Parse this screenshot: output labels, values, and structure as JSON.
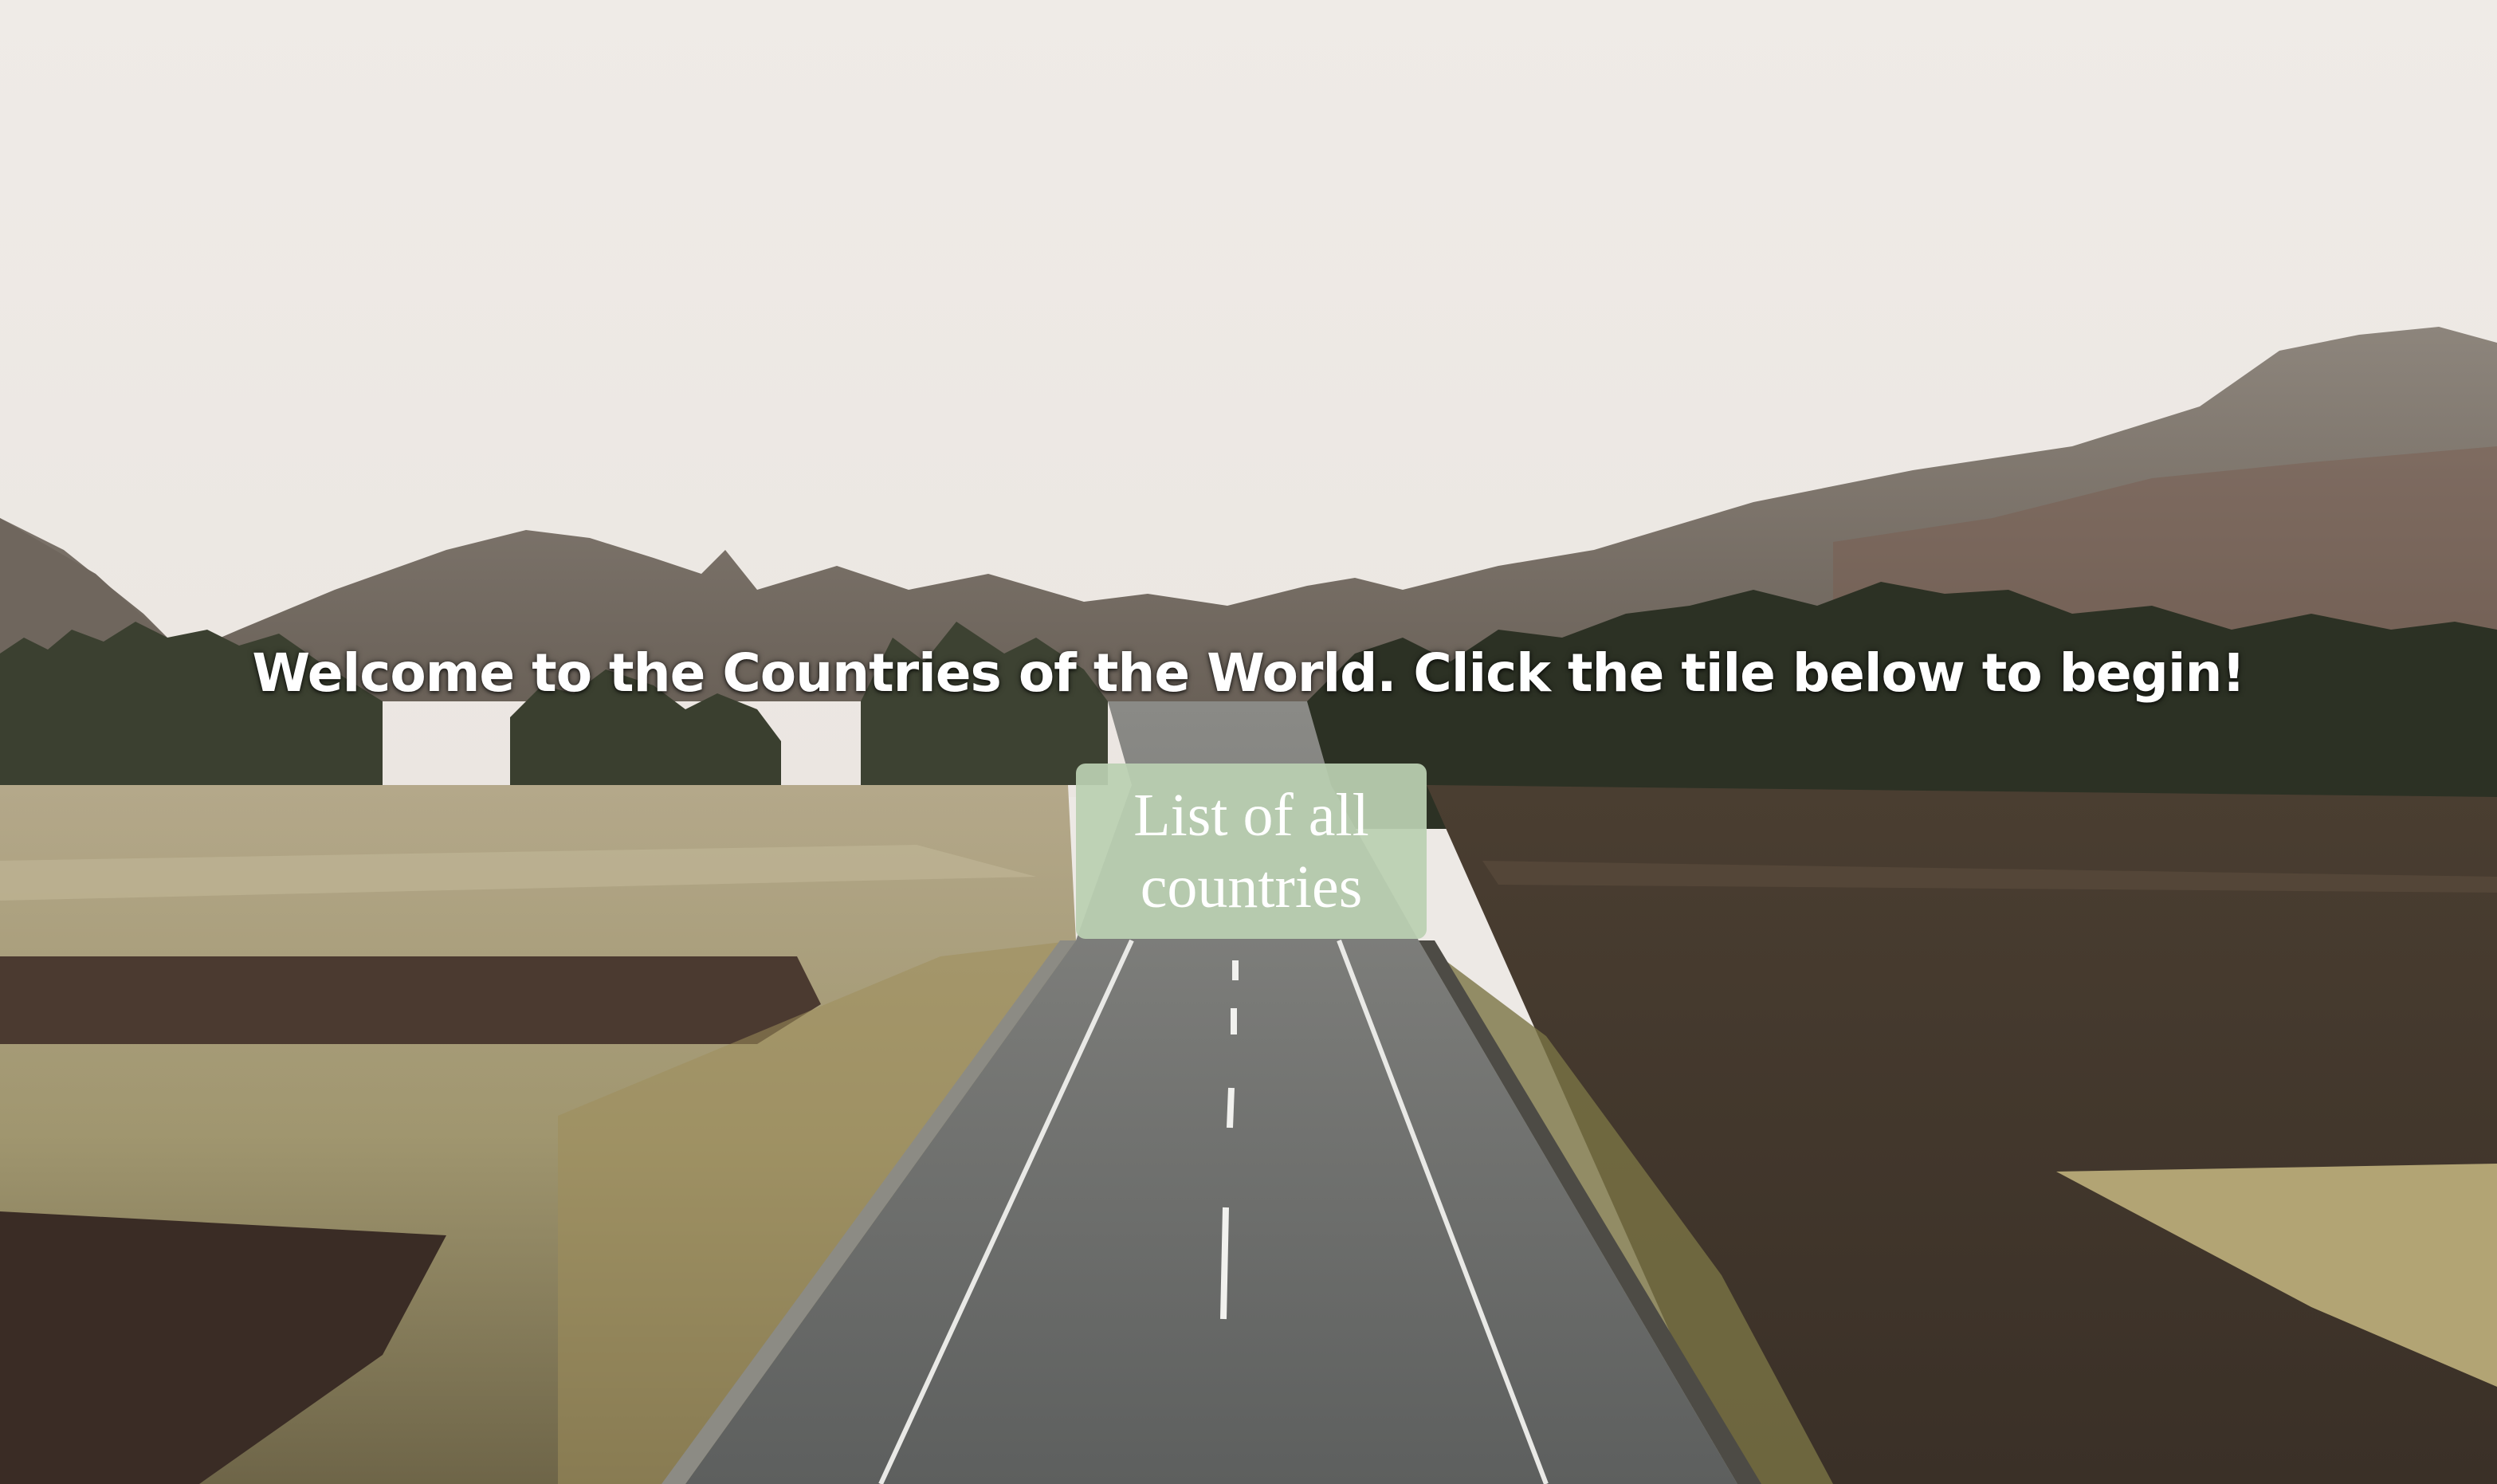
{
  "hero": {
    "welcome_text": "Welcome to the Countries of the World. Click the tile below to begin!"
  },
  "tile": {
    "label": "List of all countries",
    "background_color": "#bad0b2"
  },
  "colors": {
    "sky": "#ede9e5",
    "road": "#6c6d6c",
    "text": "#ffffff"
  }
}
